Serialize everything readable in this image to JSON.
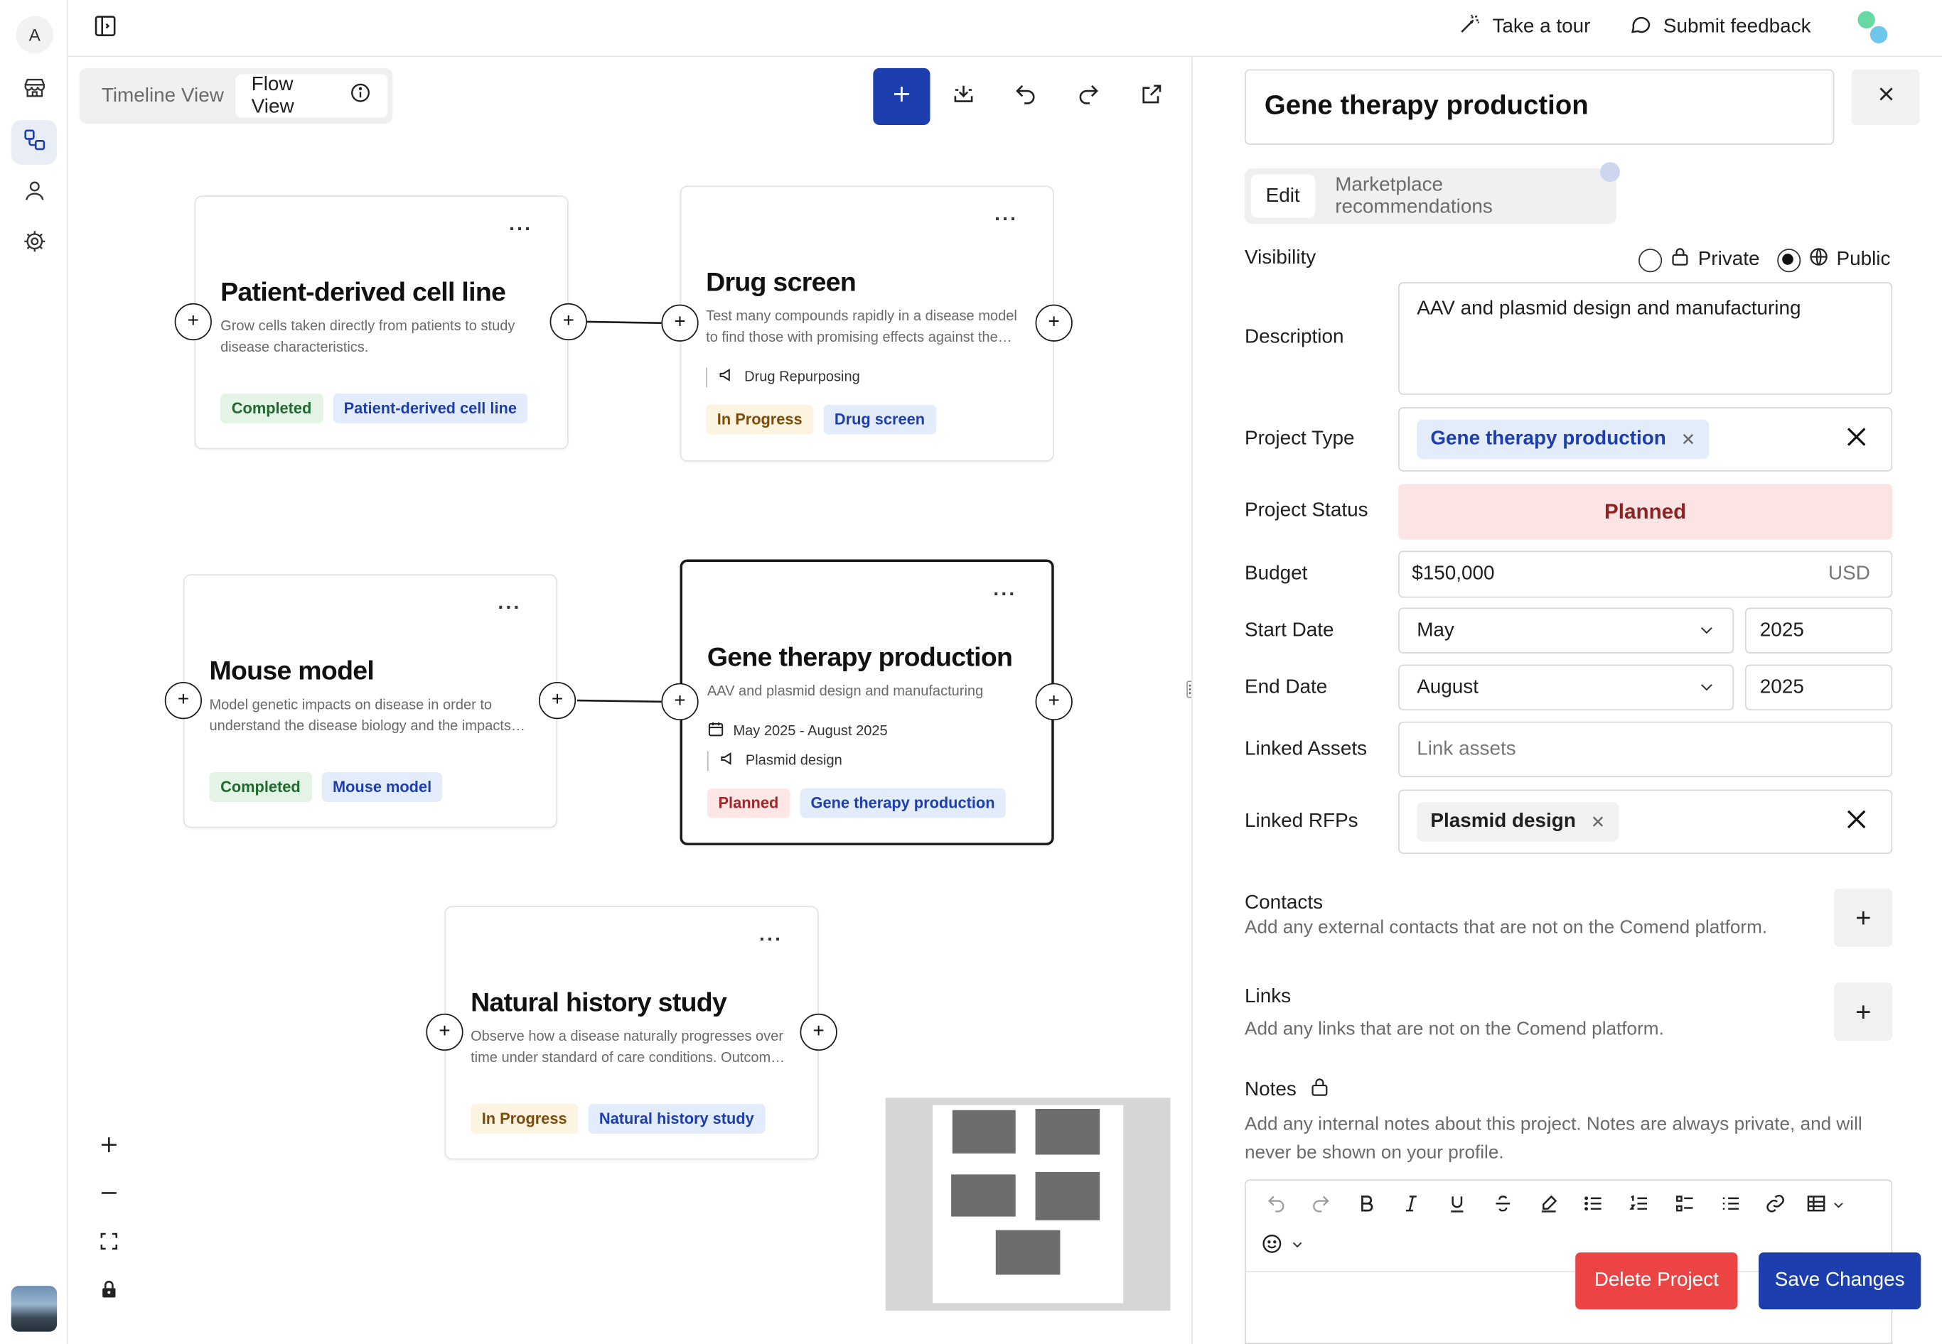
{
  "rail": {
    "user_initial": "A"
  },
  "topbar": {
    "tour_label": "Take a tour",
    "feedback_label": "Submit feedback"
  },
  "canvas": {
    "views": [
      "Timeline View",
      "Flow View"
    ],
    "active_view": "Flow View",
    "nodes": [
      {
        "title": "Patient-derived cell line",
        "description": "Grow cells taken directly from patients to study disease characteristics.",
        "status": "Completed",
        "type": "Patient-derived cell line"
      },
      {
        "title": "Drug screen",
        "description": "Test many compounds rapidly in a disease model to find those with promising effects against the disease.",
        "rfp": "Drug Repurposing",
        "status": "In Progress",
        "type": "Drug screen"
      },
      {
        "title": "Mouse model",
        "description": "Model genetic impacts on disease in order to understand the disease biology and the impacts of treatments.",
        "status": "Completed",
        "type": "Mouse model"
      },
      {
        "title": "Gene therapy production",
        "description": "AAV and plasmid design and manufacturing",
        "dates": "May 2025 - August 2025",
        "rfp": "Plasmid design",
        "status": "Planned",
        "type": "Gene therapy production"
      },
      {
        "title": "Natural history study",
        "description": "Observe how a disease naturally progresses over time under standard of care conditions. Outcomes help design trials.",
        "status": "In Progress",
        "type": "Natural history study"
      }
    ]
  },
  "panel": {
    "project_name": "Gene therapy production",
    "tabs": [
      "Edit",
      "Marketplace recommendations"
    ],
    "active_tab": "Edit",
    "visibility": {
      "label": "Visibility",
      "options": [
        "Private",
        "Public"
      ],
      "selected": "Public"
    },
    "description": {
      "label": "Description",
      "value": "AAV and plasmid design and manufacturing"
    },
    "project_type": {
      "label": "Project Type",
      "value": "Gene therapy production"
    },
    "project_status": {
      "label": "Project Status",
      "value": "Planned"
    },
    "budget": {
      "label": "Budget",
      "value": "$150,000",
      "currency": "USD"
    },
    "start_date": {
      "label": "Start Date",
      "month": "May",
      "year": "2025"
    },
    "end_date": {
      "label": "End Date",
      "month": "August",
      "year": "2025"
    },
    "linked_assets": {
      "label": "Linked Assets",
      "placeholder": "Link assets"
    },
    "linked_rfps": {
      "label": "Linked RFPs",
      "value": "Plasmid design"
    },
    "contacts": {
      "title": "Contacts",
      "subtitle": "Add any external contacts that are not on the Comend platform."
    },
    "links": {
      "title": "Links",
      "subtitle": "Add any links that are not on the Comend platform."
    },
    "notes": {
      "title": "Notes",
      "subtitle": "Add any internal notes about this project. Notes are always private, and will never be shown on your profile."
    },
    "delete_label": "Delete Project",
    "save_label": "Save Changes"
  },
  "colors": {
    "primary": "#1d3fae",
    "danger": "#ec4444",
    "planned_bg": "#fde4e4",
    "completed_bg": "#e3f3e5",
    "progress_bg": "#fdf3e1",
    "tag_bg": "#e3ecfb"
  }
}
